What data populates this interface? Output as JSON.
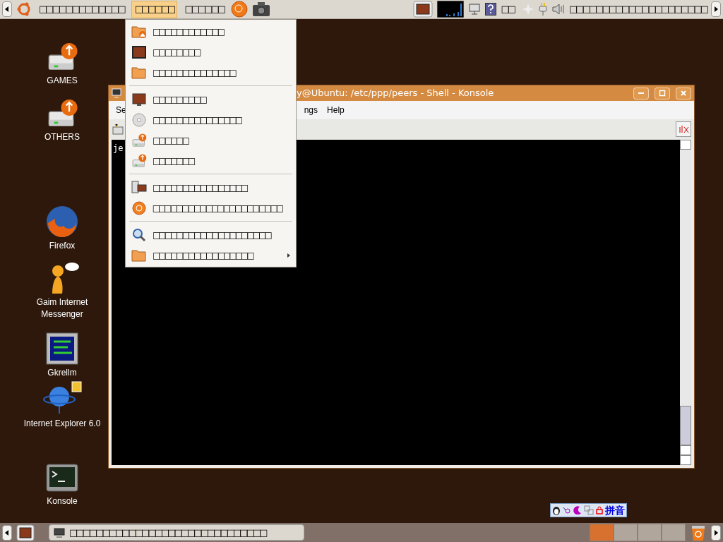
{
  "top_panel": {
    "menus": [
      {
        "label": "□□□□□□□□□□□□□",
        "selected": false
      },
      {
        "label": "□□□□□□",
        "selected": true
      },
      {
        "label": "□□□□□□",
        "selected": false
      }
    ],
    "tray_text": "□□",
    "clock": "□□□□□□□□□□□□□□□□□□□□□"
  },
  "places_menu": {
    "sections": [
      [
        {
          "label": "□□□□□□□□□□□□",
          "submenu": false
        },
        {
          "label": "□□□□□□□□",
          "submenu": false
        },
        {
          "label": "□□□□□□□□□□□□□□",
          "submenu": false
        }
      ],
      [
        {
          "label": "□□□□□□□□□",
          "submenu": false
        },
        {
          "label": "□□□□□□□□□□□□□□□",
          "submenu": false
        },
        {
          "label": "□□□□□□",
          "submenu": false
        },
        {
          "label": "□□□□□□□",
          "submenu": false
        }
      ],
      [
        {
          "label": "□□□□□□□□□□□□□□□□",
          "submenu": false
        },
        {
          "label": "□□□□□□□□□□□□□□□□□□□□□□",
          "submenu": false
        }
      ],
      [
        {
          "label": "□□□□□□□□□□□□□□□□□□□□",
          "submenu": false
        },
        {
          "label": "□□□□□□□□□□□□□□□□□",
          "submenu": true
        }
      ]
    ]
  },
  "desktop_icons": [
    {
      "label": "GAMES"
    },
    {
      "label": "OTHERS"
    },
    {
      "label": "Firefox"
    },
    {
      "label": "Gaim Internet Messenger"
    },
    {
      "label": "Gkrellm"
    },
    {
      "label": "Internet Explorer 6.0"
    },
    {
      "label": "Konsole"
    }
  ],
  "konsole": {
    "title": "y@Ubuntu: /etc/ppp/peers - Shell - Konsole",
    "menu": [
      "Se",
      "ngs",
      "Help"
    ],
    "terminal_text": "je"
  },
  "input_method": {
    "label": "拼音"
  },
  "bottom_panel": {
    "task": {
      "label": "□□□□□□□□□□□□□□□□□□□□□□□□□□□□□□"
    },
    "workspaces": [
      {
        "selected": true
      },
      {
        "selected": false
      },
      {
        "selected": false
      },
      {
        "selected": false
      }
    ]
  }
}
